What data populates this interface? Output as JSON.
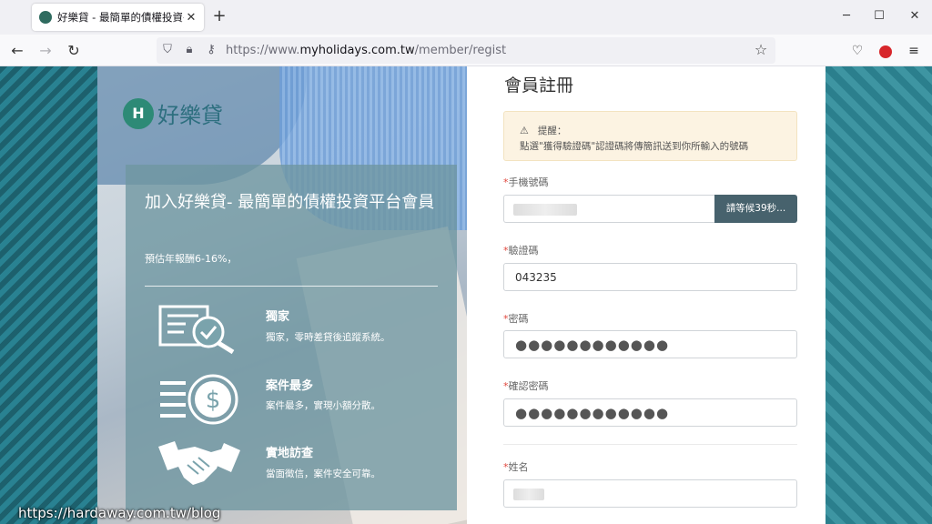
{
  "browser": {
    "tab_title": "好樂貸 - 最簡單的債權投資平台",
    "url_prefix": "https://www.",
    "url_domain": "myholidays.com.tw",
    "url_path": "/member/regist"
  },
  "hero": {
    "logo_text": "好樂貸",
    "title": "加入好樂貸- 最簡單的債權投資平台會員",
    "subtitle": "預估年報酬6-16%，",
    "features": [
      {
        "title": "獨家",
        "desc": "獨家，零時差貸後追蹤系統。"
      },
      {
        "title": "案件最多",
        "desc": "案件最多，實現小額分散。"
      },
      {
        "title": "實地訪查",
        "desc": "當面徵信，案件安全可靠。"
      }
    ]
  },
  "form": {
    "title": "會員註冊",
    "alert": {
      "heading": "提醒：",
      "body": "點選\"獲得驗證碼\"認證碼將傳簡訊送到你所輸入的號碼"
    },
    "fields": {
      "phone_label": "手機號碼",
      "phone_button": "請等候39秒...",
      "code_label": "驗證碼",
      "code_value": "043235",
      "password_label": "密碼",
      "password_value": "●●●●●●●●●●●●",
      "confirm_label": "確認密碼",
      "confirm_value": "●●●●●●●●●●●●",
      "name_label": "姓名"
    },
    "required_mark": "*"
  },
  "watermark": "https://hardaway.com.tw/blog"
}
